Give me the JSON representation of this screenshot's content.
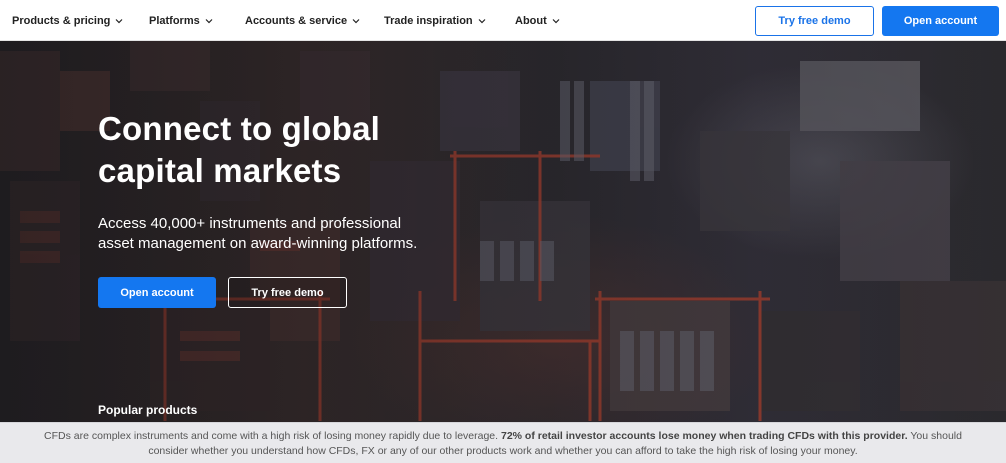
{
  "nav": {
    "items": [
      {
        "label": "Products & pricing"
      },
      {
        "label": "Platforms"
      },
      {
        "label": "Accounts & service"
      },
      {
        "label": "Trade inspiration"
      },
      {
        "label": "About"
      }
    ],
    "try_demo": "Try free demo",
    "open_account": "Open account"
  },
  "hero": {
    "headline_line1": "Connect to global",
    "headline_line2": "capital markets",
    "sub_line1": "Access 40,000+ instruments and professional",
    "sub_line2": "asset management on award-winning platforms.",
    "open_account": "Open account",
    "try_demo": "Try free demo",
    "popular_products": "Popular products"
  },
  "risk_banner": {
    "text_before": "CFDs are complex instruments and come with a high risk of losing money rapidly due to leverage. ",
    "text_bold": "72% of retail investor accounts lose money when trading CFDs with this provider.",
    "text_after": " You should consider whether you understand how CFDs, FX or any of our other products work and whether you can afford to take the high risk of losing your money."
  },
  "colors": {
    "primary_blue": "#1477f0",
    "nav_bg": "#ffffff",
    "banner_bg": "#e9e9ec"
  }
}
